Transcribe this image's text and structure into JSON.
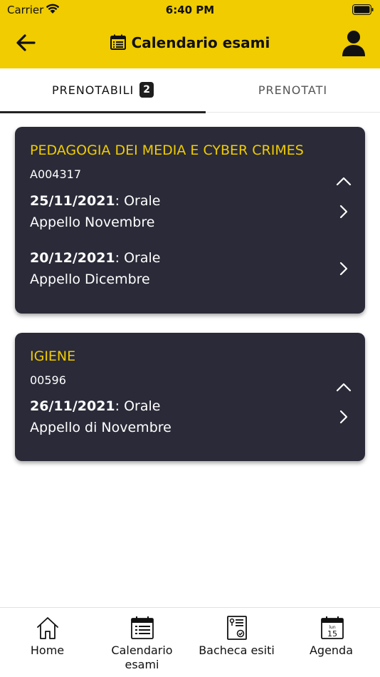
{
  "status_bar": {
    "carrier": "Carrier",
    "time": "6:40 PM"
  },
  "header": {
    "title": "Calendario esami"
  },
  "tabs": [
    {
      "label": "PRENOTABILI",
      "badge": "2"
    },
    {
      "label": "PRENOTATI"
    }
  ],
  "courses": [
    {
      "name": "PEDAGOGIA DEI MEDIA E CYBER CRIMES",
      "code": "A004317",
      "exams": [
        {
          "date": "25/11/2021",
          "type": ": Orale",
          "session": "Appello Novembre"
        },
        {
          "date": "20/12/2021",
          "type": ": Orale",
          "session": "Appello Dicembre"
        }
      ]
    },
    {
      "name": "IGIENE",
      "code": "00596",
      "exams": [
        {
          "date": "26/11/2021",
          "type": ": Orale",
          "session": "Appello di Novembre"
        }
      ]
    }
  ],
  "bottom_nav": {
    "home": "Home",
    "calendar_line1": "Calendario",
    "calendar_line2": "esami",
    "results": "Bacheca esiti",
    "agenda": "Agenda",
    "agenda_icon_day": "lun",
    "agenda_icon_date": "15"
  },
  "colors": {
    "accent": "#f0cc00",
    "card": "#2a2a38",
    "tab_active": "#222222"
  }
}
